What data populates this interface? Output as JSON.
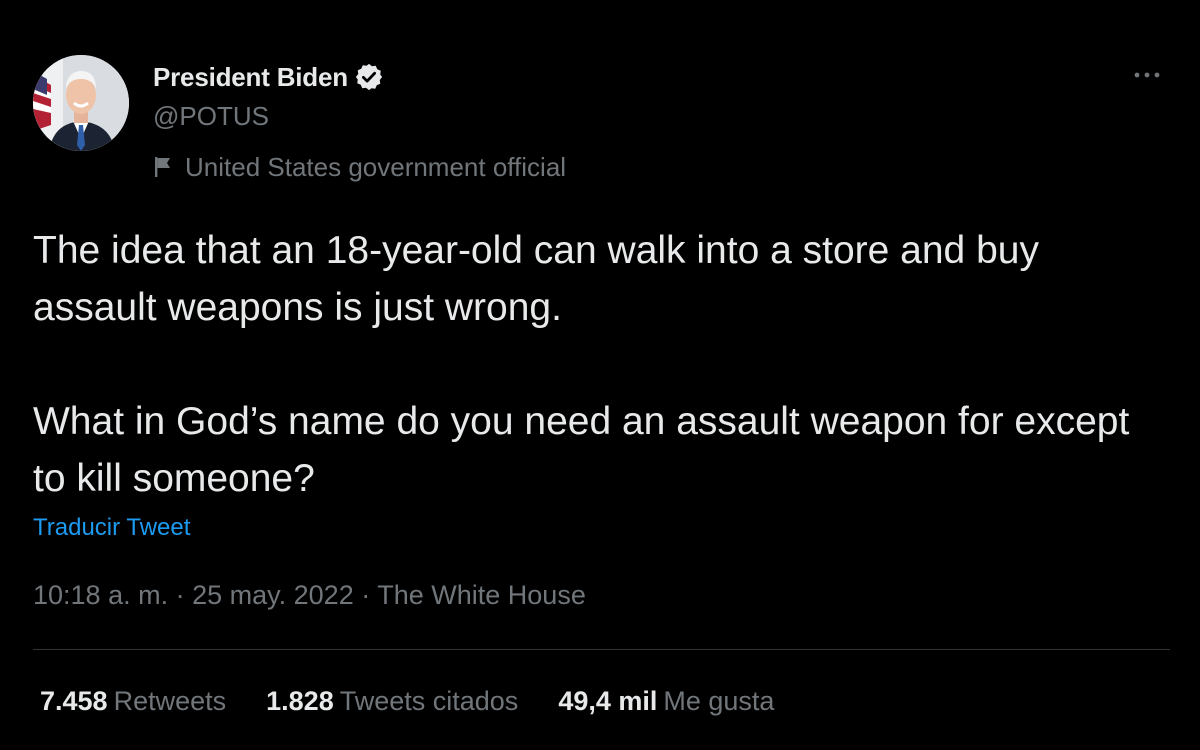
{
  "author": {
    "name": "President Biden",
    "handle": "@POTUS",
    "label": "United States government official",
    "verified": true
  },
  "tweet": {
    "paragraphs": [
      "The idea that an 18-year-old can walk into a store and buy assault weapons is just wrong.",
      "What in God’s name do you need an assault weapon for except to kill someone?"
    ],
    "translate_label": "Traducir Tweet",
    "time": "10:18 a. m.",
    "date": "25 may. 2022",
    "source": "The White House",
    "separator": "·"
  },
  "stats": {
    "retweets": {
      "value": "7.458",
      "label": "Retweets"
    },
    "quotes": {
      "value": "1.828",
      "label": "Tweets citados"
    },
    "likes": {
      "value": "49,4 mil",
      "label": "Me gusta"
    }
  },
  "icons": {
    "verified": "verified-badge-icon",
    "flag": "flag-icon",
    "more": "more-dots-icon"
  },
  "colors": {
    "background": "#000000",
    "text": "#e7e9ea",
    "secondary": "#71767b",
    "link": "#1d9bf0",
    "divider": "#2f3336"
  }
}
